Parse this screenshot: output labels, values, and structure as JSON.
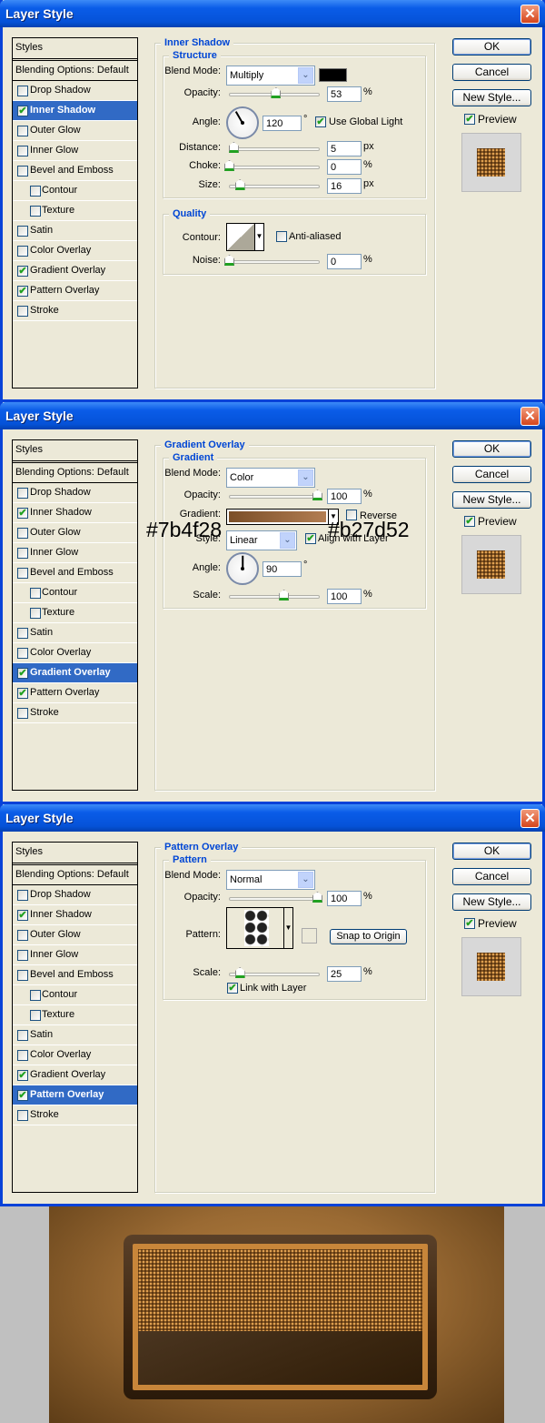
{
  "window_title": "Layer Style",
  "sidebar_header": "Styles",
  "blending_options": "Blending Options: Default",
  "buttons": {
    "ok": "OK",
    "cancel": "Cancel",
    "new_style": "New Style...",
    "preview": "Preview",
    "preview_checked": true
  },
  "icons": {
    "close": "close-icon",
    "chevron": "chevron-down-icon",
    "check": "checkmark-icon"
  },
  "colors": {
    "accent": "#316ac5",
    "titlebar": "#0552d8",
    "face": "#ece9d8",
    "group_title": "#0046d5"
  },
  "dialogs": [
    {
      "selected": 1,
      "items": [
        {
          "label": "Drop Shadow",
          "checked": false,
          "indent": false
        },
        {
          "label": "Inner Shadow",
          "checked": true,
          "indent": false
        },
        {
          "label": "Outer Glow",
          "checked": false,
          "indent": false
        },
        {
          "label": "Inner Glow",
          "checked": false,
          "indent": false
        },
        {
          "label": "Bevel and Emboss",
          "checked": false,
          "indent": false
        },
        {
          "label": "Contour",
          "checked": false,
          "indent": true
        },
        {
          "label": "Texture",
          "checked": false,
          "indent": true
        },
        {
          "label": "Satin",
          "checked": false,
          "indent": false
        },
        {
          "label": "Color Overlay",
          "checked": false,
          "indent": false
        },
        {
          "label": "Gradient Overlay",
          "checked": true,
          "indent": false
        },
        {
          "label": "Pattern Overlay",
          "checked": true,
          "indent": false
        },
        {
          "label": "Stroke",
          "checked": false,
          "indent": false
        }
      ],
      "section_title": "Inner Shadow",
      "group1_title": "Structure",
      "blend_label": "Blend Mode:",
      "blend_value": "Multiply",
      "shadow_color": "#000000",
      "opacity": {
        "label": "Opacity:",
        "value": "53",
        "unit": "%",
        "fraction": 0.53
      },
      "angle": {
        "label": "Angle:",
        "value": "120",
        "unit": "°",
        "degrees": 120
      },
      "global_light": {
        "label": "Use Global Light",
        "checked": true
      },
      "distance": {
        "label": "Distance:",
        "value": "5",
        "unit": "px",
        "fraction": 0.05
      },
      "choke": {
        "label": "Choke:",
        "value": "0",
        "unit": "%",
        "fraction": 0
      },
      "size": {
        "label": "Size:",
        "value": "16",
        "unit": "px",
        "fraction": 0.12
      },
      "group2_title": "Quality",
      "contour_label": "Contour:",
      "anti_aliased": {
        "label": "Anti-aliased",
        "checked": false
      },
      "noise": {
        "label": "Noise:",
        "value": "0",
        "unit": "%",
        "fraction": 0
      }
    },
    {
      "selected": 9,
      "items": [
        {
          "label": "Drop Shadow",
          "checked": false,
          "indent": false
        },
        {
          "label": "Inner Shadow",
          "checked": true,
          "indent": false
        },
        {
          "label": "Outer Glow",
          "checked": false,
          "indent": false
        },
        {
          "label": "Inner Glow",
          "checked": false,
          "indent": false
        },
        {
          "label": "Bevel and Emboss",
          "checked": false,
          "indent": false
        },
        {
          "label": "Contour",
          "checked": false,
          "indent": true
        },
        {
          "label": "Texture",
          "checked": false,
          "indent": true
        },
        {
          "label": "Satin",
          "checked": false,
          "indent": false
        },
        {
          "label": "Color Overlay",
          "checked": false,
          "indent": false
        },
        {
          "label": "Gradient Overlay",
          "checked": true,
          "indent": false
        },
        {
          "label": "Pattern Overlay",
          "checked": true,
          "indent": false
        },
        {
          "label": "Stroke",
          "checked": false,
          "indent": false
        }
      ],
      "section_title": "Gradient Overlay",
      "group1_title": "Gradient",
      "blend_label": "Blend Mode:",
      "blend_value": "Color",
      "opacity": {
        "label": "Opacity:",
        "value": "100",
        "unit": "%",
        "fraction": 1
      },
      "gradient_label": "Gradient:",
      "gradient_start": "#7b4f28",
      "gradient_end": "#b27d52",
      "reverse": {
        "label": "Reverse",
        "checked": false
      },
      "style_label": "Style:",
      "style_value": "Linear",
      "align": {
        "label": "Align with Layer",
        "checked": true
      },
      "angle": {
        "label": "Angle:",
        "value": "90",
        "unit": "°",
        "degrees": 90
      },
      "scale": {
        "label": "Scale:",
        "value": "100",
        "unit": "%",
        "fraction": 0.62
      },
      "annotation_start": "#7b4f28",
      "annotation_end": "#b27d52"
    },
    {
      "selected": 10,
      "items": [
        {
          "label": "Drop Shadow",
          "checked": false,
          "indent": false
        },
        {
          "label": "Inner Shadow",
          "checked": true,
          "indent": false
        },
        {
          "label": "Outer Glow",
          "checked": false,
          "indent": false
        },
        {
          "label": "Inner Glow",
          "checked": false,
          "indent": false
        },
        {
          "label": "Bevel and Emboss",
          "checked": false,
          "indent": false
        },
        {
          "label": "Contour",
          "checked": false,
          "indent": true
        },
        {
          "label": "Texture",
          "checked": false,
          "indent": true
        },
        {
          "label": "Satin",
          "checked": false,
          "indent": false
        },
        {
          "label": "Color Overlay",
          "checked": false,
          "indent": false
        },
        {
          "label": "Gradient Overlay",
          "checked": true,
          "indent": false
        },
        {
          "label": "Pattern Overlay",
          "checked": true,
          "indent": false
        },
        {
          "label": "Stroke",
          "checked": false,
          "indent": false
        }
      ],
      "section_title": "Pattern Overlay",
      "group1_title": "Pattern",
      "blend_label": "Blend Mode:",
      "blend_value": "Normal",
      "opacity": {
        "label": "Opacity:",
        "value": "100",
        "unit": "%",
        "fraction": 1
      },
      "pattern_label": "Pattern:",
      "snap_label": "Snap to Origin",
      "scale": {
        "label": "Scale:",
        "value": "25",
        "unit": "%",
        "fraction": 0.12
      },
      "link": {
        "label": "Link with Layer",
        "checked": true
      }
    }
  ]
}
